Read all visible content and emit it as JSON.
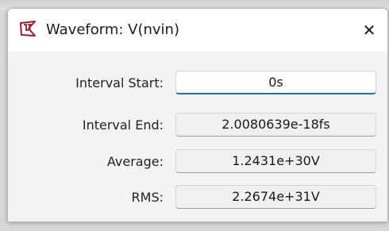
{
  "window": {
    "title": "Waveform: V(nvin)",
    "close_glyph": "✕",
    "icon": "ltspice-app-icon",
    "accent_color": "#1f6fbf"
  },
  "fields": [
    {
      "label": "Interval Start:",
      "value": "0s"
    },
    {
      "label": "Interval End:",
      "value": "2.0080639e-18fs"
    },
    {
      "label": "Average:",
      "value": "1.2431e+30V"
    },
    {
      "label": "RMS:",
      "value": "2.2674e+31V"
    }
  ]
}
